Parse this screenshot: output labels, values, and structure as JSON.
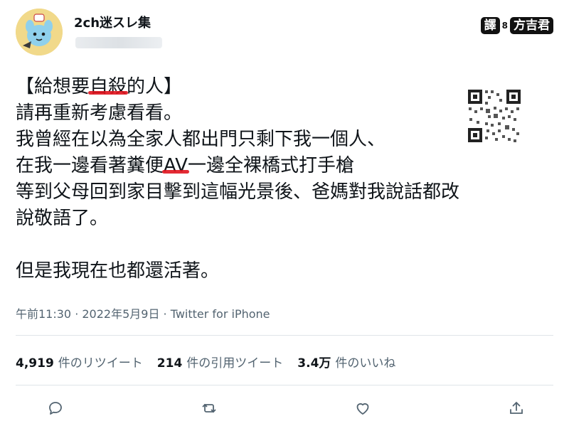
{
  "author": {
    "display_name": "2ch迷スレ集"
  },
  "watermark": {
    "chip_left": "譯",
    "separator": "8",
    "chip_right": "方吉君"
  },
  "tweet": {
    "lines": [
      "【給想要自殺的人】",
      "請再重新考慮看看。",
      "我曾經在以為全家人都出門只剩下我一個人、",
      "在我一邊看著糞便AV一邊全裸橋式打手槍",
      "等到父母回到家目擊到這幅光景後、爸媽對我說話都改",
      "說敬語了。",
      "",
      "但是我現在也都還活著。"
    ],
    "line1_pre": "【給想要",
    "line1_hl": "自殺",
    "line1_post": "的人】",
    "line4_pre": "在我一邊看著糞便",
    "line4_hl": "AV",
    "line4_post": "一邊全裸橋式打手槍"
  },
  "meta": {
    "text": "午前11:30 · 2022年5月9日 · Twitter for iPhone"
  },
  "stats": {
    "retweets_count": "4,919",
    "retweets_label": "件のリツイート",
    "quotes_count": "214",
    "quotes_label": "件の引用ツイート",
    "likes_count": "3.4万",
    "likes_label": "件のいいね"
  },
  "actions": [
    "reply-icon",
    "retweet-icon",
    "like-icon",
    "share-icon"
  ],
  "colors": {
    "text": "#0f1419",
    "muted": "#536471",
    "divider": "#dfe4e8",
    "highlight": "#e0141e",
    "avatar_bg": "#f1d98a"
  }
}
